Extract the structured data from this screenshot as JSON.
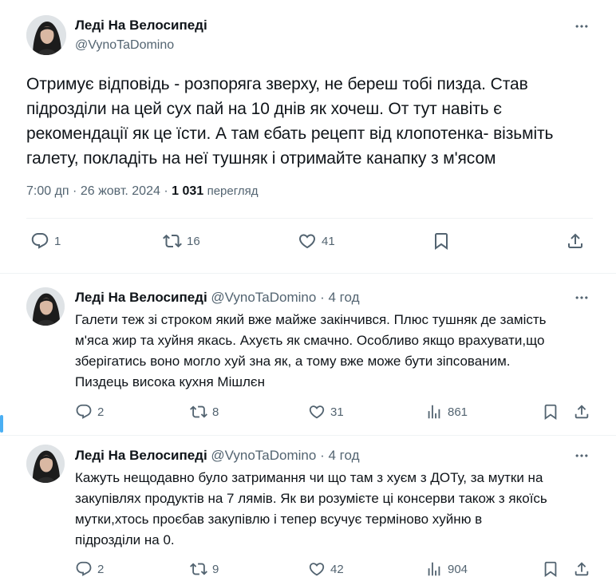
{
  "main_tweet": {
    "author_name": "Леді На Велосипеді",
    "author_handle": "@VynoTaDomino",
    "text_lines": [
      "Отримує відповідь - розпоряга зверху, не береш тобі пизда. Став",
      "підрозділи на цей сух пай на 10 днів як хочеш. От тут навіть є",
      "рекомендації як це їсти. А там єбать рецепт від клопотенка- візьміть",
      "галету, покладіть на неї тушняк і отримайте канапку з м'ясом"
    ],
    "time": "7:00 дп",
    "sep": "·",
    "date": "26 жовт. 2024",
    "views_count": "1 031",
    "views_label": "перегляд",
    "replies": "1",
    "reposts": "16",
    "likes": "41"
  },
  "replies": [
    {
      "author_name": "Леді На Велосипеді",
      "author_handle": "@VynoTaDomino",
      "dot": "·",
      "time": "4 год",
      "text_lines": [
        "Галети теж зі строком який вже майже закінчився. Плюс тушняк де замість",
        "м'яса жир та хуйня якась. Ахуєть як смачно. Особливо якщо врахувати,що",
        "зберігатись воно могло хуй зна як, а тому вже може бути зіпсованим.",
        "Пиздець висока кухня Мішлєн"
      ],
      "replies": "2",
      "reposts": "8",
      "likes": "31",
      "views": "861"
    },
    {
      "author_name": "Леді На Велосипеді",
      "author_handle": "@VynoTaDomino",
      "dot": "·",
      "time": "4 год",
      "text_lines": [
        "Кажуть нещодавно було затримання чи що там з хуєм з ДОТу, за мутки на",
        "закупівлях продуктів на 7 лямів. Як ви розумієте ці консерви також з якоїсь",
        "мутки,хтось проєбав закупівлю і тепер всучує терміново хуйню в",
        "підрозділи на 0."
      ],
      "replies": "2",
      "reposts": "9",
      "likes": "42",
      "views": "904"
    }
  ],
  "icons": {
    "reply": "reply-icon",
    "repost": "repost-icon",
    "like": "heart-icon",
    "bookmark": "bookmark-icon",
    "share": "share-icon",
    "views": "views-icon",
    "more": "more-icon"
  },
  "colors": {
    "text": "#0f1419",
    "secondary": "#536471",
    "divider": "#eff3f4",
    "accent": "#1d9bf0"
  }
}
